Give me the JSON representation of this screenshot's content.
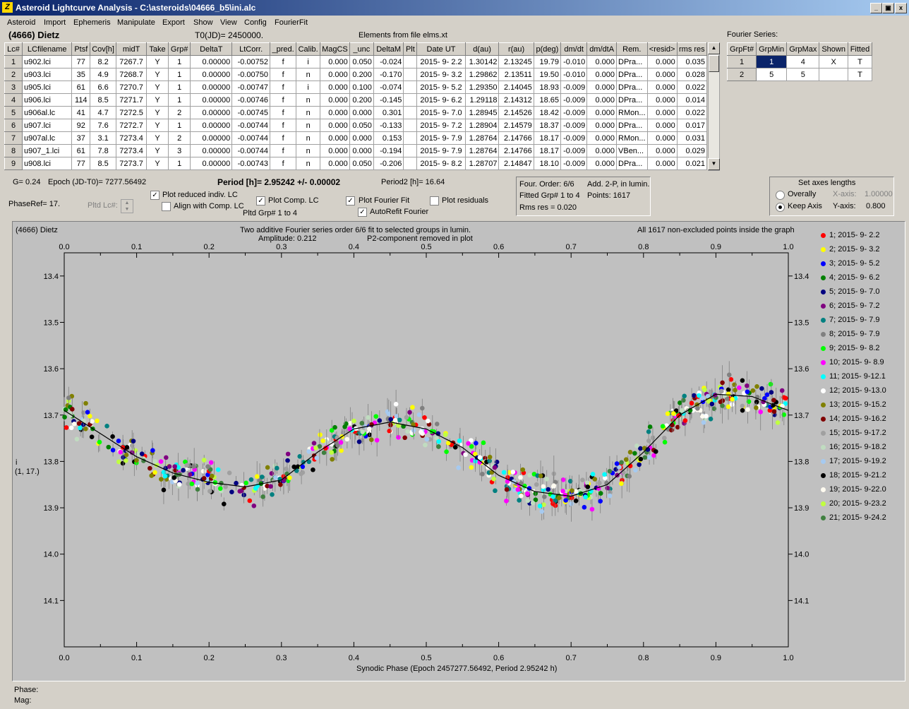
{
  "window": {
    "title": "Asteroid Lightcurve Analysis - C:\\asteroids\\04666_b5\\ini.alc",
    "min": "_",
    "max": "▣",
    "close": "x"
  },
  "menu": [
    "Asteroid",
    "Import",
    "Ephemeris",
    "Manipulate",
    "Export",
    "Show",
    "View",
    "Config",
    "FourierFit"
  ],
  "info": {
    "asteroid": "(4666) Dietz",
    "t0": "T0(JD)= 2450000.",
    "elements": "Elements from file elms.xt"
  },
  "table": {
    "headers": [
      "Lc#",
      "LCfilename",
      "Ptsf",
      "Cov[h]",
      "midT",
      "Take",
      "Grp#",
      "DeltaT",
      "LtCorr.",
      "_pred.",
      "Calib.",
      "MagCS",
      "_unc",
      "DeltaM",
      "Plt",
      "Date UT",
      "d(au)",
      "r(au)",
      "p(deg)",
      "dm/dt",
      "dm/dtA",
      "Rem.",
      "<resid>",
      "rms res"
    ],
    "rows": [
      [
        "1",
        "u902.lci",
        "77",
        "8.2",
        "7267.7",
        "Y",
        "1",
        "0.00000",
        "-0.00752",
        "f",
        "i",
        "0.000",
        "0.050",
        "-0.024",
        "",
        "2015- 9- 2.2",
        "1.30142",
        "2.13245",
        "19.79",
        "-0.010",
        "0.000",
        "DPra...",
        "0.000",
        "0.035"
      ],
      [
        "2",
        "u903.lci",
        "35",
        "4.9",
        "7268.7",
        "Y",
        "1",
        "0.00000",
        "-0.00750",
        "f",
        "n",
        "0.000",
        "0.200",
        "-0.170",
        "",
        "2015- 9- 3.2",
        "1.29862",
        "2.13511",
        "19.50",
        "-0.010",
        "0.000",
        "DPra...",
        "0.000",
        "0.028"
      ],
      [
        "3",
        "u905.lci",
        "61",
        "6.6",
        "7270.7",
        "Y",
        "1",
        "0.00000",
        "-0.00747",
        "f",
        "i",
        "0.000",
        "0.100",
        "-0.074",
        "",
        "2015- 9- 5.2",
        "1.29350",
        "2.14045",
        "18.93",
        "-0.009",
        "0.000",
        "DPra...",
        "0.000",
        "0.022"
      ],
      [
        "4",
        "u906.lci",
        "114",
        "8.5",
        "7271.7",
        "Y",
        "1",
        "0.00000",
        "-0.00746",
        "f",
        "n",
        "0.000",
        "0.200",
        "-0.145",
        "",
        "2015- 9- 6.2",
        "1.29118",
        "2.14312",
        "18.65",
        "-0.009",
        "0.000",
        "DPra...",
        "0.000",
        "0.014"
      ],
      [
        "5",
        "u906al.lc",
        "41",
        "4.7",
        "7272.5",
        "Y",
        "2",
        "0.00000",
        "-0.00745",
        "f",
        "n",
        "0.000",
        "0.000",
        "0.301",
        "",
        "2015- 9- 7.0",
        "1.28945",
        "2.14526",
        "18.42",
        "-0.009",
        "0.000",
        "RMon...",
        "0.000",
        "0.022"
      ],
      [
        "6",
        "u907.lci",
        "92",
        "7.6",
        "7272.7",
        "Y",
        "1",
        "0.00000",
        "-0.00744",
        "f",
        "n",
        "0.000",
        "0.050",
        "-0.133",
        "",
        "2015- 9- 7.2",
        "1.28904",
        "2.14579",
        "18.37",
        "-0.009",
        "0.000",
        "DPra...",
        "0.000",
        "0.017"
      ],
      [
        "7",
        "u907al.lc",
        "37",
        "3.1",
        "7273.4",
        "Y",
        "2",
        "0.00000",
        "-0.00744",
        "f",
        "n",
        "0.000",
        "0.000",
        "0.153",
        "",
        "2015- 9- 7.9",
        "1.28764",
        "2.14766",
        "18.17",
        "-0.009",
        "0.000",
        "RMon...",
        "0.000",
        "0.031"
      ],
      [
        "8",
        "u907_1.lci",
        "61",
        "7.8",
        "7273.4",
        "Y",
        "3",
        "0.00000",
        "-0.00744",
        "f",
        "n",
        "0.000",
        "0.000",
        "-0.194",
        "",
        "2015- 9- 7.9",
        "1.28764",
        "2.14766",
        "18.17",
        "-0.009",
        "0.000",
        "VBen...",
        "0.000",
        "0.029"
      ],
      [
        "9",
        "u908.lci",
        "77",
        "8.5",
        "7273.7",
        "Y",
        "1",
        "0.00000",
        "-0.00743",
        "f",
        "n",
        "0.000",
        "0.050",
        "-0.206",
        "",
        "2015- 9- 8.2",
        "1.28707",
        "2.14847",
        "18.10",
        "-0.009",
        "0.000",
        "DPra...",
        "0.000",
        "0.021"
      ]
    ]
  },
  "fourier_series": {
    "label": "Fourier Series:",
    "headers": [
      "GrpFt#",
      "GrpMin",
      "GrpMax",
      "Shown",
      "Fitted"
    ],
    "rows": [
      [
        "1",
        "1",
        "4",
        "X",
        "T"
      ],
      [
        "2",
        "5",
        "5",
        "",
        "T"
      ]
    ]
  },
  "params": {
    "g": "G= 0.24",
    "epoch": "Epoch (JD-T0)= 7277.56492",
    "period": "Period [h]= 2.95242 +/- 0.00002",
    "period2": "Period2 [h]= 16.64",
    "phaseref": "PhaseRef= 17.",
    "pltd_lc": "Pltd Lc#:",
    "pltd_grp": "Pltd Grp#  1   to   4",
    "plot_reduced": "Plot reduced indiv. LC",
    "align": "Align with Comp. LC",
    "plot_comp": "Plot Comp. LC",
    "plot_fourier": "Plot Fourier Fit",
    "autorefit": "AutoRefit Fourier",
    "plot_resid": "Plot residuals"
  },
  "fit_info": {
    "order": "Four. Order:  6/6",
    "add": "Add. 2-P, in lumin.",
    "fitted": "Fitted Grp# 1 to 4",
    "points": "Points: 1617",
    "rms": "Rms res     = 0.020"
  },
  "axes_box": {
    "title": "Set axes lengths",
    "overally": "Overally",
    "keep": "Keep Axis",
    "xlabel": "X-axis:",
    "xval": "1.00000",
    "ylabel": "Y-axis:",
    "yval": "0.800"
  },
  "plot": {
    "name": "(4666) Dietz",
    "desc1": "Two additive Fourier series order 6/6 fit to selected groups in lumin.",
    "amp": "Amplitude: 0.212",
    "p2": "P2-component removed in plot",
    "count": "All 1617 non-excluded points inside the graph",
    "ylabel1": "i",
    "ylabel2": "(1, 17.)",
    "xlabel": "Synodic Phase (Epoch 2457277.56492, Period 2.95242 h)"
  },
  "legend": [
    {
      "label": "1; 2015- 9- 2.2",
      "color": "#ff0000"
    },
    {
      "label": "2; 2015- 9- 3.2",
      "color": "#ffff00"
    },
    {
      "label": "3; 2015- 9- 5.2",
      "color": "#0000ff"
    },
    {
      "label": "4; 2015- 9- 6.2",
      "color": "#008000"
    },
    {
      "label": "5; 2015- 9- 7.0",
      "color": "#000080"
    },
    {
      "label": "6; 2015- 9- 7.2",
      "color": "#800080"
    },
    {
      "label": "7; 2015- 9- 7.9",
      "color": "#008080"
    },
    {
      "label": "8; 2015- 9- 7.9",
      "color": "#808080"
    },
    {
      "label": "9; 2015- 9- 8.2",
      "color": "#00ff00"
    },
    {
      "label": "10; 2015- 9- 8.9",
      "color": "#ff00ff"
    },
    {
      "label": "11; 2015- 9-12.1",
      "color": "#00ffff"
    },
    {
      "label": "12; 2015- 9-13.0",
      "color": "#ffffff"
    },
    {
      "label": "13; 2015- 9-15.2",
      "color": "#808000"
    },
    {
      "label": "14; 2015- 9-16.2",
      "color": "#800000"
    },
    {
      "label": "15; 2015- 9-17.2",
      "color": "#a0a0a0"
    },
    {
      "label": "16; 2015- 9-18.2",
      "color": "#c0dcc0"
    },
    {
      "label": "17; 2015- 9-19.2",
      "color": "#a6caf0"
    },
    {
      "label": "18; 2015- 9-21.2",
      "color": "#000000"
    },
    {
      "label": "19; 2015- 9-22.0",
      "color": "#fffbf0"
    },
    {
      "label": "20; 2015- 9-23.2",
      "color": "#c0ff40"
    },
    {
      "label": "21; 2015- 9-24.2",
      "color": "#408040"
    }
  ],
  "status": {
    "phase": "Phase:",
    "mag": "Mag:"
  },
  "chart_data": {
    "type": "scatter",
    "xlabel": "Synodic Phase (Epoch 2457277.56492, Period 2.95242 h)",
    "ylabel": "",
    "xlim": [
      0.0,
      1.0
    ],
    "ylim": [
      14.2,
      13.35
    ],
    "y_inverted": true,
    "xticks": [
      "0.0",
      "0.1",
      "0.2",
      "0.3",
      "0.4",
      "0.5",
      "0.6",
      "0.7",
      "0.8",
      "0.9",
      "1.0"
    ],
    "yticks": [
      "13.4",
      "13.5",
      "13.6",
      "13.7",
      "13.8",
      "13.9",
      "14.0",
      "14.1"
    ],
    "fit_curve": {
      "x": [
        0.0,
        0.05,
        0.1,
        0.15,
        0.2,
        0.25,
        0.3,
        0.35,
        0.4,
        0.45,
        0.5,
        0.55,
        0.6,
        0.65,
        0.7,
        0.75,
        0.8,
        0.85,
        0.9,
        0.95,
        1.0
      ],
      "y": [
        13.69,
        13.74,
        13.79,
        13.825,
        13.845,
        13.855,
        13.84,
        13.78,
        13.73,
        13.715,
        13.73,
        13.77,
        13.83,
        13.865,
        13.875,
        13.85,
        13.78,
        13.7,
        13.655,
        13.66,
        13.69
      ]
    },
    "points": "1617"
  }
}
